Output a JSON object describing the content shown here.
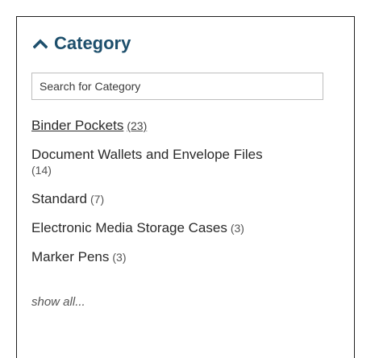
{
  "filter": {
    "title": "Category",
    "search_placeholder": "Search for Category",
    "items": [
      {
        "label": "Binder Pockets",
        "count": "(23)",
        "selected": true
      },
      {
        "label": "Document Wallets and Envelope Files",
        "count": "(14)",
        "selected": false
      },
      {
        "label": "Standard",
        "count": "(7)",
        "selected": false
      },
      {
        "label": "Electronic Media Storage Cases",
        "count": "(3)",
        "selected": false
      },
      {
        "label": "Marker Pens",
        "count": "(3)",
        "selected": false
      }
    ],
    "show_all_label": "show all..."
  },
  "colors": {
    "title": "#1d4f6c",
    "text": "#2a2a2a",
    "border": "#1f1f1f"
  },
  "icons": {
    "collapse": "chevron-up-icon"
  }
}
